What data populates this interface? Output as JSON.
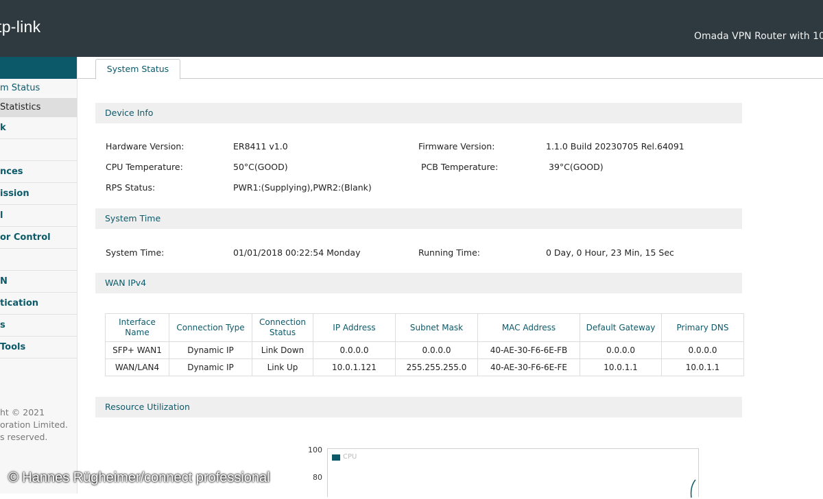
{
  "header": {
    "logo_text": "tp-link",
    "product_name": "Omada VPN Router with 10"
  },
  "sidebar": {
    "items": [
      {
        "label": "m Status",
        "type": "sub"
      },
      {
        "label": " Statistics",
        "type": "sub-active"
      },
      {
        "label": "k",
        "type": "main"
      },
      {
        "label": "",
        "type": "main"
      },
      {
        "label": "nces",
        "type": "main"
      },
      {
        "label": "ission",
        "type": "main"
      },
      {
        "label": "l",
        "type": "main"
      },
      {
        "label": "or Control",
        "type": "main"
      },
      {
        "label": "",
        "type": "main"
      },
      {
        "label": "N",
        "type": "main"
      },
      {
        "label": "tication",
        "type": "main"
      },
      {
        "label": "s",
        "type": "main"
      },
      {
        "label": " Tools",
        "type": "main"
      }
    ],
    "copyright_lines": [
      "ht © 2021",
      "oration Limited.",
      "s reserved."
    ]
  },
  "tab": {
    "label": "System Status"
  },
  "device_info": {
    "title": "Device Info",
    "hardware_label": "Hardware Version:",
    "hardware_value": "ER8411 v1.0",
    "firmware_label": "Firmware Version:",
    "firmware_value": "1.1.0 Build 20230705 Rel.64091",
    "cpu_temp_label": "CPU Temperature:",
    "cpu_temp_value": "50°C(GOOD)",
    "pcb_temp_label": "PCB Temperature:",
    "pcb_temp_value": "39°C(GOOD)",
    "rps_label": "RPS Status:",
    "rps_value": "PWR1:(Supplying),PWR2:(Blank)"
  },
  "system_time": {
    "title": "System Time",
    "time_label": "System Time:",
    "time_value": "01/01/2018 00:22:54 Monday",
    "running_label": "Running Time:",
    "running_value": "0 Day, 0 Hour, 23 Min, 15 Sec"
  },
  "wan": {
    "title": "WAN IPv4",
    "headers": [
      "Interface\nName",
      "Connection Type",
      "Connection\nStatus",
      "IP Address",
      "Subnet Mask",
      "MAC Address",
      "Default Gateway",
      "Primary DNS"
    ],
    "rows": [
      [
        "SFP+ WAN1",
        "Dynamic IP",
        "Link Down",
        "0.0.0.0",
        "0.0.0.0",
        "40-AE-30-F6-6E-FB",
        "0.0.0.0",
        "0.0.0.0"
      ],
      [
        "WAN/LAN4",
        "Dynamic IP",
        "Link Up",
        "10.0.1.121",
        "255.255.255.0",
        "40-AE-30-F6-6E-FE",
        "10.0.1.1",
        "10.0.1.1"
      ]
    ]
  },
  "resource": {
    "title": "Resource Utilization",
    "chart_ticks": [
      "100",
      "80"
    ],
    "legend_label": "CPU",
    "legend_color": "#0b5969"
  },
  "watermark": "© Hannes Rüghe​imer/connect professional",
  "colors": {
    "topbar": "#2e3a3f",
    "accent": "#0b5969",
    "section_bg": "#efefef"
  }
}
